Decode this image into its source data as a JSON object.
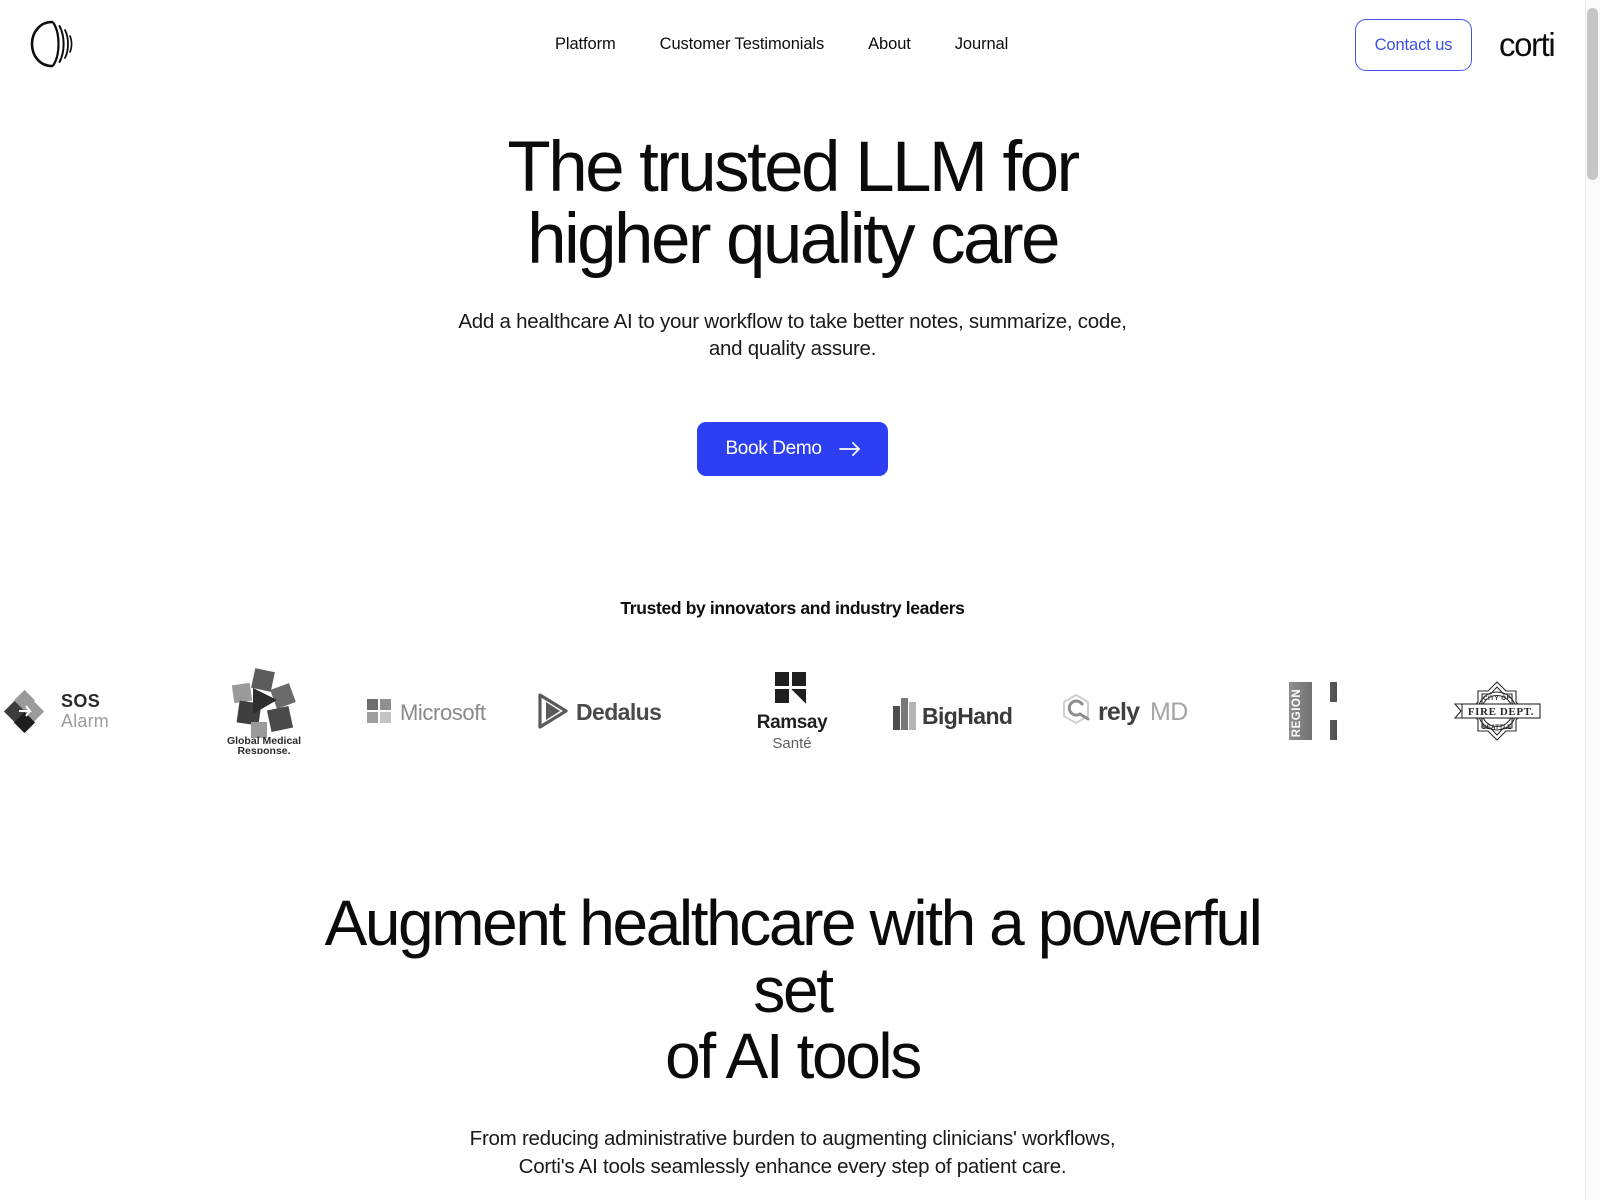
{
  "brand": {
    "logo_icon": "corti-waveform-logo-icon",
    "wordmark": "corti"
  },
  "header": {
    "nav": [
      {
        "label": "Platform"
      },
      {
        "label": "Customer Testimonials"
      },
      {
        "label": "About"
      },
      {
        "label": "Journal"
      }
    ],
    "contact_label": "Contact us",
    "contact_border_color": "#4456e6",
    "contact_text_color": "#3b4fe4"
  },
  "hero": {
    "title_line1": "The trusted LLM for",
    "title_line2": "higher quality care",
    "subtitle_line1": "Add a healthcare AI to your workflow to take better notes, summarize, code,",
    "subtitle_line2": "and quality assure.",
    "cta_label": "Book Demo",
    "cta_icon": "arrow-right-icon",
    "cta_bg_color": "#2d3ff2",
    "cta_text_color": "#ffffff"
  },
  "trusted": {
    "title": "Trusted by innovators and industry leaders",
    "logos": [
      {
        "name": "sos-alarm",
        "primary": "SOS",
        "secondary": "Alarm"
      },
      {
        "name": "global-medical-response",
        "primary": "Global Medical",
        "secondary": "Response."
      },
      {
        "name": "microsoft",
        "primary": "Microsoft",
        "secondary": ""
      },
      {
        "name": "dedalus",
        "primary": "Dedalus",
        "secondary": ""
      },
      {
        "name": "ramsay-sante",
        "primary": "Ramsay",
        "secondary": "Santé"
      },
      {
        "name": "bighand",
        "primary": "BigHand",
        "secondary": ""
      },
      {
        "name": "relymd",
        "primary": "rely",
        "secondary": "MD"
      },
      {
        "name": "region-h",
        "primary": "REGION",
        "secondary": "H"
      },
      {
        "name": "seattle-fire-dept",
        "primary": "FIRE DEPT.",
        "secondary": "CITY OF",
        "tertiary": "SEATTLE"
      }
    ]
  },
  "section2": {
    "title_line1": "Augment healthcare with a powerful set",
    "title_line2": "of AI tools",
    "subtitle_line1": "From reducing administrative burden to augmenting clinicians' workflows,",
    "subtitle_line2": "Corti's AI tools seamlessly enhance every step of patient care."
  },
  "scrollbar": {
    "thumb_color": "#c6c6c6"
  }
}
